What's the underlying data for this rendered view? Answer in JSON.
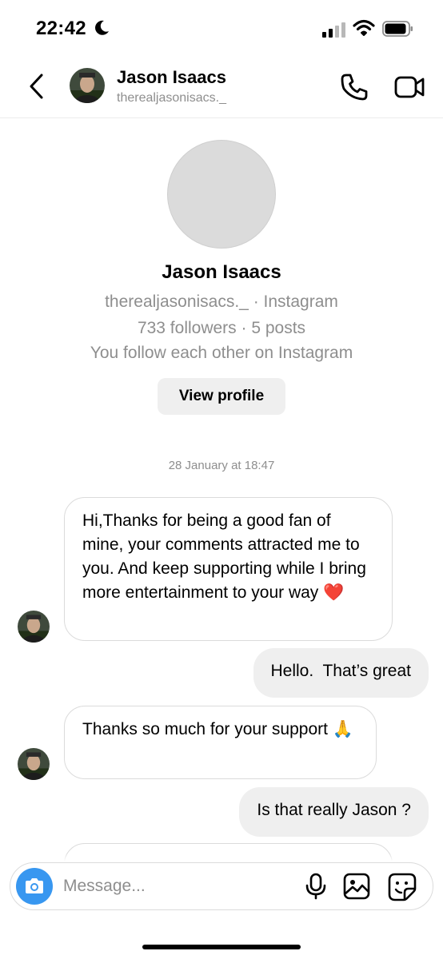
{
  "status_bar": {
    "time": "22:42",
    "icons": [
      "moon-icon",
      "signal-icon",
      "wifi-icon",
      "battery-icon"
    ]
  },
  "header": {
    "name": "Jason Isaacs",
    "username": "therealjasonisacs._",
    "icons": [
      "back-icon",
      "call-icon",
      "video-call-icon"
    ]
  },
  "profile": {
    "name": "Jason Isaacs",
    "subtitle": "therealjasonisacs._ · Instagram",
    "stats": "733 followers · 5 posts",
    "mutual": "You follow each other on Instagram",
    "view_profile_label": "View profile"
  },
  "thread": {
    "timestamp": "28 January at 18:47",
    "messages": [
      {
        "from": "them",
        "text": "Hi,Thanks for being a good fan of mine, your comments attracted me to you. And keep supporting while I bring more entertainment to your way ❤️"
      },
      {
        "from": "me",
        "text": "Hello.  That’s great"
      },
      {
        "from": "them",
        "text": "Thanks so much for your support 🙏"
      },
      {
        "from": "me",
        "text": "Is that really Jason ?"
      },
      {
        "from": "them",
        "text": ""
      }
    ]
  },
  "composer": {
    "placeholder": "Message...",
    "icons": [
      "camera-icon",
      "microphone-icon",
      "gallery-icon",
      "sticker-icon"
    ]
  },
  "colors": {
    "accent": "#3897f0",
    "outgoing_bubble": "#efefef",
    "incoming_border": "#dbdbdb",
    "secondary_text": "#8e8e8e",
    "heart": "#e0245e"
  }
}
